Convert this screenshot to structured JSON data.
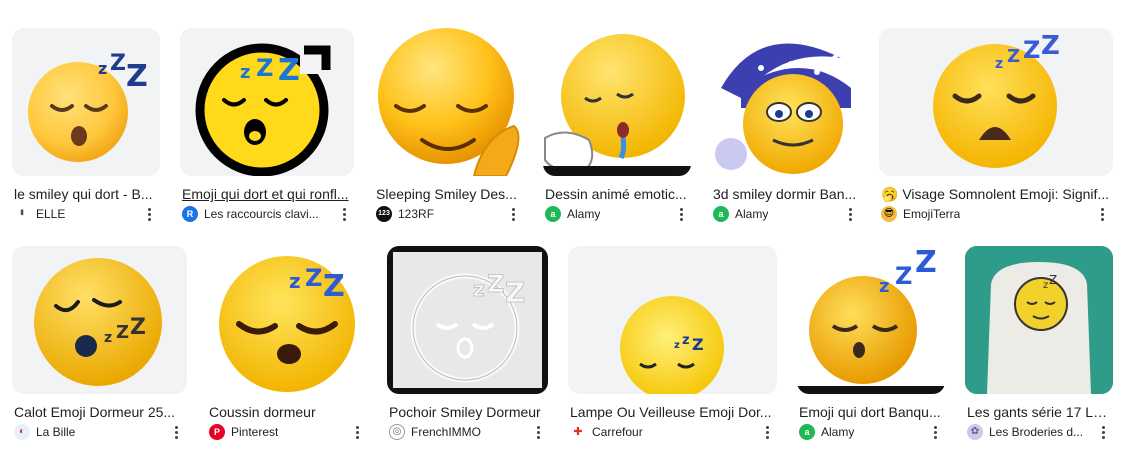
{
  "results": [
    {
      "title": "le smiley qui dort - B...",
      "source": "ELLE",
      "favicon": "elle-icon",
      "fav_color": "#ffffff",
      "fav_text": "ELLE"
    },
    {
      "title": "Emoji qui dort et qui ronfl...",
      "source": "Les raccourcis clavi...",
      "favicon": "raccourcis-icon",
      "fav_color": "#1a73e8",
      "fav_text": "R"
    },
    {
      "title": "Sleeping Smiley Des...",
      "source": "123RF",
      "favicon": "123rf-icon",
      "fav_color": "#111111",
      "fav_text": "123"
    },
    {
      "title": "Dessin animé emotic...",
      "source": "Alamy",
      "favicon": "alamy-icon",
      "fav_color": "#1db954",
      "fav_text": "a"
    },
    {
      "title": "3d smiley dormir Ban...",
      "source": "Alamy",
      "favicon": "alamy-icon",
      "fav_color": "#1db954",
      "fav_text": "a"
    },
    {
      "title": "🥱 Visage Somnolent Emoji: Signif...",
      "source": "EmojiTerra",
      "favicon": "emojiterra-icon",
      "fav_color": "#f6b93b",
      "fav_text": "😎"
    },
    {
      "title": "Calot Emoji Dormeur 25...",
      "source": "La Bille",
      "favicon": "labille-icon",
      "fav_color": "#e8f0fe",
      "fav_text": "◐"
    },
    {
      "title": "Coussin dormeur",
      "source": "Pinterest",
      "favicon": "pinterest-icon",
      "fav_color": "#e60023",
      "fav_text": "P"
    },
    {
      "title": "Pochoir Smiley Dormeur",
      "source": "FrenchIMMO",
      "favicon": "frenchimmo-icon",
      "fav_color": "#ffffff",
      "fav_text": "◎"
    },
    {
      "title": "Lampe Ou Veilleuse Emoji Dor...",
      "source": "Carrefour",
      "favicon": "carrefour-icon",
      "fav_color": "#ffffff",
      "fav_text": "✚"
    },
    {
      "title": "Emoji qui dort Banqu...",
      "source": "Alamy",
      "favicon": "alamy-icon",
      "fav_color": "#1db954",
      "fav_text": "a"
    },
    {
      "title": "Les gants série 17 Le...",
      "source": "Les Broderies d...",
      "favicon": "broderies-icon",
      "fav_color": "#d0c8e8",
      "fav_text": "✿"
    }
  ],
  "more_label": "More options"
}
